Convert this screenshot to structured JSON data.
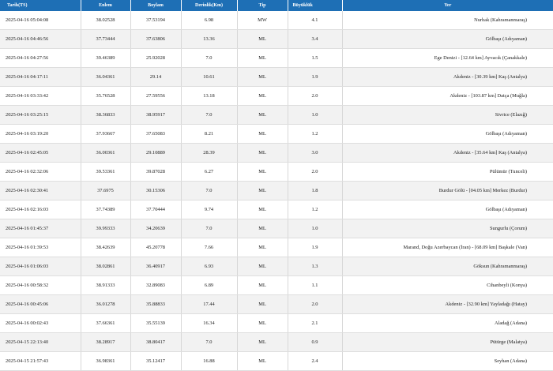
{
  "header": {
    "date": "Tarih(TS)",
    "lat": "Enlem",
    "lon": "Boylam",
    "depth": "Derinlik(Km)",
    "type": "Tip",
    "mag": "Büyüklük",
    "place": "Yer"
  },
  "rows": [
    {
      "date": "2025-04-16 05:04:08",
      "lat": "38.02528",
      "lon": "37.53194",
      "depth": "6.98",
      "type": "MW",
      "mag": "4.1",
      "place": "Nurhak (Kahramanmaraş)"
    },
    {
      "date": "2025-04-16 04:46:56",
      "lat": "37.73444",
      "lon": "37.63806",
      "depth": "13.36",
      "type": "ML",
      "mag": "3.4",
      "place": "Gölbaşı (Adıyaman)"
    },
    {
      "date": "2025-04-16 04:27:56",
      "lat": "39.46389",
      "lon": "25.92028",
      "depth": "7.0",
      "type": "ML",
      "mag": "1.5",
      "place": "Ege Denizi - [12.64 km] Ayvacık (Çanakkale)"
    },
    {
      "date": "2025-04-16 04:17:11",
      "lat": "36.04361",
      "lon": "29.14",
      "depth": "10.61",
      "type": "ML",
      "mag": "1.9",
      "place": "Akdeniz - [30.39 km] Kaş (Antalya)"
    },
    {
      "date": "2025-04-16 03:33:42",
      "lat": "35.76528",
      "lon": "27.59556",
      "depth": "13.18",
      "type": "ML",
      "mag": "2.0",
      "place": "Akdeniz - [103.87 km] Datça (Muğla)"
    },
    {
      "date": "2025-04-16 03:25:15",
      "lat": "38.36833",
      "lon": "38.95917",
      "depth": "7.0",
      "type": "ML",
      "mag": "1.0",
      "place": "Sivrice (Elazığ)"
    },
    {
      "date": "2025-04-16 03:19:20",
      "lat": "37.93667",
      "lon": "37.65083",
      "depth": "8.21",
      "type": "ML",
      "mag": "1.2",
      "place": "Gölbaşı (Adıyaman)"
    },
    {
      "date": "2025-04-16 02:45:05",
      "lat": "36.00361",
      "lon": "29.10889",
      "depth": "28.39",
      "type": "ML",
      "mag": "3.0",
      "place": "Akdeniz - [35.64 km] Kaş (Antalya)"
    },
    {
      "date": "2025-04-16 02:32:06",
      "lat": "39.53361",
      "lon": "39.87028",
      "depth": "6.27",
      "type": "ML",
      "mag": "2.0",
      "place": "Pülümür (Tunceli)"
    },
    {
      "date": "2025-04-16 02:30:41",
      "lat": "37.6975",
      "lon": "30.15306",
      "depth": "7.0",
      "type": "ML",
      "mag": "1.8",
      "place": "Burdur Gölü - [04.05 km] Merkez (Burdur)"
    },
    {
      "date": "2025-04-16 02:16:03",
      "lat": "37.74389",
      "lon": "37.70444",
      "depth": "9.74",
      "type": "ML",
      "mag": "1.2",
      "place": "Gölbaşı (Adıyaman)"
    },
    {
      "date": "2025-04-16 01:45:37",
      "lat": "39.99333",
      "lon": "34.20639",
      "depth": "7.0",
      "type": "ML",
      "mag": "1.0",
      "place": "Sungurlu (Çorum)"
    },
    {
      "date": "2025-04-16 01:39:53",
      "lat": "38.42639",
      "lon": "45.20778",
      "depth": "7.66",
      "type": "ML",
      "mag": "1.9",
      "place": "Marand, Doğu Azerbaycan (İran) - [68.09 km] Başkale (Van)"
    },
    {
      "date": "2025-04-16 01:06:03",
      "lat": "38.02861",
      "lon": "36.40917",
      "depth": "6.93",
      "type": "ML",
      "mag": "1.3",
      "place": "Göksun (Kahramanmaraş)"
    },
    {
      "date": "2025-04-16 00:58:32",
      "lat": "38.91333",
      "lon": "32.89083",
      "depth": "6.89",
      "type": "ML",
      "mag": "1.1",
      "place": "Cihanbeyli (Konya)"
    },
    {
      "date": "2025-04-16 00:45:06",
      "lat": "36.01278",
      "lon": "35.88833",
      "depth": "17.44",
      "type": "ML",
      "mag": "2.0",
      "place": "Akdeniz - [32.90 km] Yayladağı (Hatay)"
    },
    {
      "date": "2025-04-16 00:02:43",
      "lat": "37.66361",
      "lon": "35.55139",
      "depth": "16.34",
      "type": "ML",
      "mag": "2.1",
      "place": "Aladağ (Adana)"
    },
    {
      "date": "2025-04-15 22:13:40",
      "lat": "38.28917",
      "lon": "38.80417",
      "depth": "7.0",
      "type": "ML",
      "mag": "0.9",
      "place": "Pütürge (Malatya)"
    },
    {
      "date": "2025-04-15 21:57:43",
      "lat": "36.98361",
      "lon": "35.12417",
      "depth": "16.88",
      "type": "ML",
      "mag": "2.4",
      "place": "Seyhan (Adana)"
    }
  ],
  "colors": {
    "header_bg": "#1e6fb5",
    "row_alt_bg": "#f2f2f2"
  }
}
